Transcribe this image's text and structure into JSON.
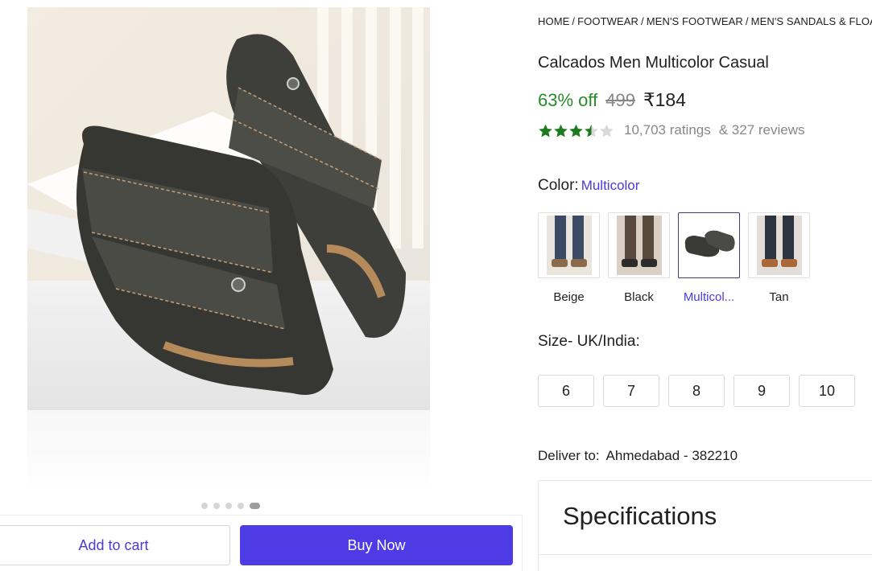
{
  "breadcrumb": [
    "HOME",
    "FOOTWEAR",
    "MEN'S FOOTWEAR",
    "MEN'S SANDALS & FLOATERS"
  ],
  "product": {
    "title": "Calcados Men Multicolor Casual",
    "discount": "63% off",
    "mrp": "499",
    "price": "₹184",
    "rating_value": 3.5,
    "ratings_text": "10,703 ratings",
    "reviews_text": "& 327 reviews"
  },
  "color": {
    "label": "Color:",
    "selected": "Multicolor",
    "variants": [
      {
        "name": "Beige",
        "selected": false
      },
      {
        "name": "Black",
        "selected": false
      },
      {
        "name": "Multicol...",
        "selected": true
      },
      {
        "name": "Tan",
        "selected": false
      }
    ]
  },
  "size": {
    "label": "Size- UK/India:",
    "options": [
      "6",
      "7",
      "8",
      "9",
      "10"
    ]
  },
  "delivery": {
    "label": "Deliver to:",
    "location": "Ahmedabad - 382210"
  },
  "specifications": {
    "title": "Specifications"
  },
  "gallery": {
    "image_count": 5,
    "active_index": 4
  },
  "actions": {
    "add_to_cart": "Add to cart",
    "buy_now": "Buy Now"
  },
  "colors": {
    "accent": "#4d3be6",
    "discount": "#2a8a2a",
    "star": "#1e7a1e"
  }
}
